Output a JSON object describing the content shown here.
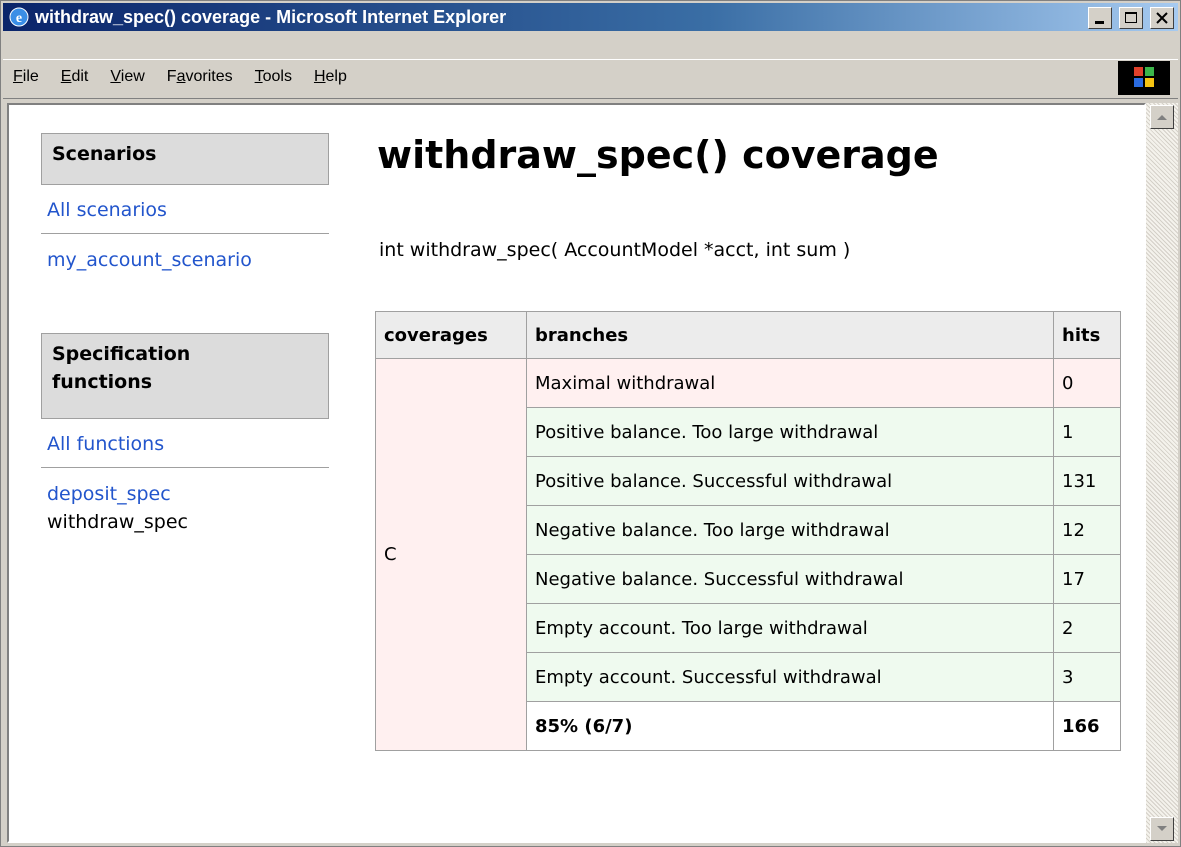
{
  "window": {
    "title": "withdraw_spec() coverage - Microsoft Internet Explorer",
    "title_color": "#0a246a"
  },
  "menu": {
    "items": [
      {
        "u": "F",
        "rest": "ile"
      },
      {
        "u": "E",
        "rest": "dit"
      },
      {
        "u": "V",
        "rest": "iew"
      },
      {
        "pre": "F",
        "u": "a",
        "rest": "vorites"
      },
      {
        "u": "T",
        "rest": "ools"
      },
      {
        "u": "H",
        "rest": "elp"
      }
    ]
  },
  "sidebar": {
    "scenarios_heading": "Scenarios",
    "all_scenarios": "All scenarios",
    "scenario_link": "my_account_scenario",
    "functions_heading_line1": "Specification",
    "functions_heading_line2": "functions",
    "all_functions": "All functions",
    "deposit_link": "deposit_spec",
    "current_function": "withdraw_spec"
  },
  "main": {
    "title": "withdraw_spec() coverage",
    "signature": "int withdraw_spec( AccountModel *acct, int sum )"
  },
  "table": {
    "headers": [
      "coverages",
      "branches",
      "hits"
    ],
    "coverage": "C",
    "rows": [
      {
        "branch": "Maximal withdrawal",
        "hits": "0",
        "status": "uncovered"
      },
      {
        "branch": "Positive balance. Too large withdrawal",
        "hits": "1",
        "status": "covered"
      },
      {
        "branch": "Positive balance. Successful withdrawal",
        "hits": "131",
        "status": "covered"
      },
      {
        "branch": "Negative balance. Too large withdrawal",
        "hits": "12",
        "status": "covered"
      },
      {
        "branch": "Negative balance. Successful withdrawal",
        "hits": "17",
        "status": "covered"
      },
      {
        "branch": "Empty account. Too large withdrawal",
        "hits": "2",
        "status": "covered"
      },
      {
        "branch": "Empty account. Successful withdrawal",
        "hits": "3",
        "status": "covered"
      }
    ],
    "total_label": "85% (6/7)",
    "total_hits": "166",
    "colors": {
      "uncovered": "#fff0f0",
      "covered": "#effaef",
      "link": "#2255cc"
    }
  }
}
